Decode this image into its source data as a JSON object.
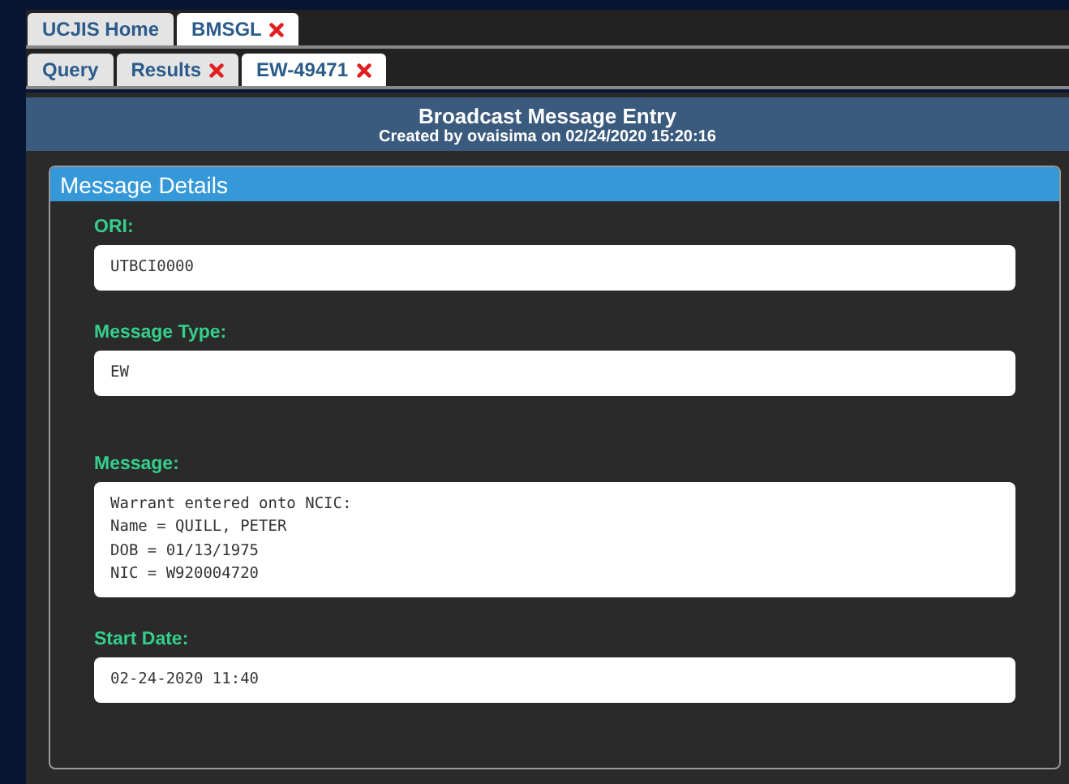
{
  "top_tabs": [
    {
      "label": "UCJIS Home",
      "selected": false,
      "closable": false
    },
    {
      "label": "BMSGL",
      "selected": true,
      "closable": true
    }
  ],
  "sub_tabs": [
    {
      "label": "Query",
      "selected": false,
      "closable": false
    },
    {
      "label": "Results",
      "selected": false,
      "closable": true
    },
    {
      "label": "EW-49471",
      "selected": true,
      "closable": true
    }
  ],
  "header": {
    "title": "Broadcast Message Entry",
    "subtitle": "Created by ovaisima on 02/24/2020 15:20:16"
  },
  "card": {
    "title": "Message Details",
    "fields": [
      {
        "label": "ORI:",
        "value": "UTBCI0000",
        "kind": "input"
      },
      {
        "label": "Message Type:",
        "value": "EW",
        "kind": "input"
      },
      {
        "label": "Message:",
        "value": "Warrant entered onto NCIC:\nName = QUILL, PETER\nDOB = 01/13/1975\nNIC = W920004720",
        "kind": "textarea"
      },
      {
        "label": "Start Date:",
        "value": "02-24-2020 11:40",
        "kind": "input"
      }
    ]
  }
}
